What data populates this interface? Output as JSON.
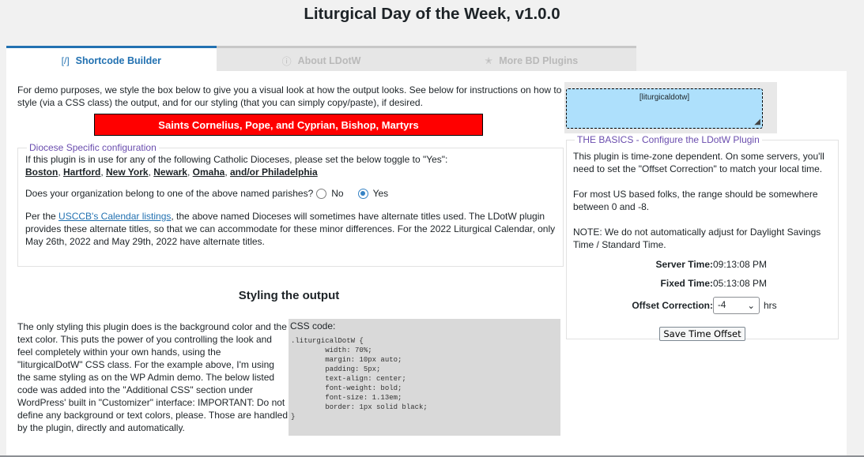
{
  "header": {
    "title": "Liturgical Day of the Week, v1.0.0"
  },
  "tabs": [
    {
      "icon": "[/]",
      "label": "Shortcode Builder"
    },
    {
      "icon": "ⓘ",
      "label": "About LDotW"
    },
    {
      "icon": "✭",
      "label": "More BD Plugins"
    }
  ],
  "intro": "For demo purposes, we style the box below to give you a visual look at how the output looks. See below for instructions on how to style (via a CSS class) the output, and for our styling (that you can simply copy/paste), if desired.",
  "demo_banner": "Saints Cornelius, Pope, and Cyprian, Bishop, Martyrs",
  "diocese": {
    "legend": "Diocese Specific configuration",
    "text": "If this plugin is in use for any of the following Catholic Dioceses, please set the below toggle to \"Yes\":",
    "cities": [
      "Boston",
      "Hartford",
      "New York",
      "Newark",
      "Omaha",
      "and/or Philadelphia"
    ],
    "question": "Does your organization belong to one of the above named parishes?",
    "option_no": "No",
    "option_yes": "Yes",
    "selected": "Yes",
    "alt_prefix": "Per the ",
    "alt_link": "USCCB's Calendar listings",
    "alt_suffix": ", the above named Dioceses will sometimes have alternate titles used. The LDotW plugin provides these alternate titles, so that we can accommodate for these minor differences. For the 2022 Liturgical Calendar, only May 26th, 2022 and May 29th, 2022 have alternate titles."
  },
  "styling": {
    "heading": "Styling the output",
    "text": "The only styling this plugin does is the background color and the text color. This puts the power of you controlling the look and feel completely within your own hands, using the \"liturgicalDotW\" CSS class. For the example above, I'm using the same styling as on the WP Admin demo. The below listed code was added into the \"Additional CSS\" section under WordPress' built in \"Customizer\" interface: IMPORTANT: Do not define any background or text colors, please. Those are handled by the plugin, directly and automatically.",
    "css_label": "CSS code:",
    "css_code": ".liturgicalDotW {\n        width: 70%;\n        margin: 10px auto;\n        padding: 5px;\n        text-align: center;\n        font-weight: bold;\n        font-size: 1.13em;\n        border: 1px solid black;\n}"
  },
  "shortcode_preview": "[liturgicaldotw]",
  "basics": {
    "legend": "THE BASICS - Configure the LDotW Plugin",
    "p1": "This plugin is time-zone dependent. On some servers, you'll need to set the \"Offset Correction\" to match your local time.",
    "p2": "For most US based folks, the range should be somewhere between 0 and -8.",
    "p3_bold": "NOTE:",
    "p3": " We do not automatically adjust for Daylight Savings Time / Standard Time.",
    "server_time_label": "Server Time:",
    "server_time": "09:13:08 PM",
    "fixed_time_label": "Fixed Time:",
    "fixed_time": "05:13:08 PM",
    "offset_label": "Offset Correction:",
    "offset_value": "-4",
    "offset_unit": "hrs",
    "save_button": "Save Time Offset"
  },
  "colors": {
    "accent": "#2271b1",
    "banner": "#ff0000",
    "preview": "#aee0fc",
    "legend": "#6a4dae"
  }
}
